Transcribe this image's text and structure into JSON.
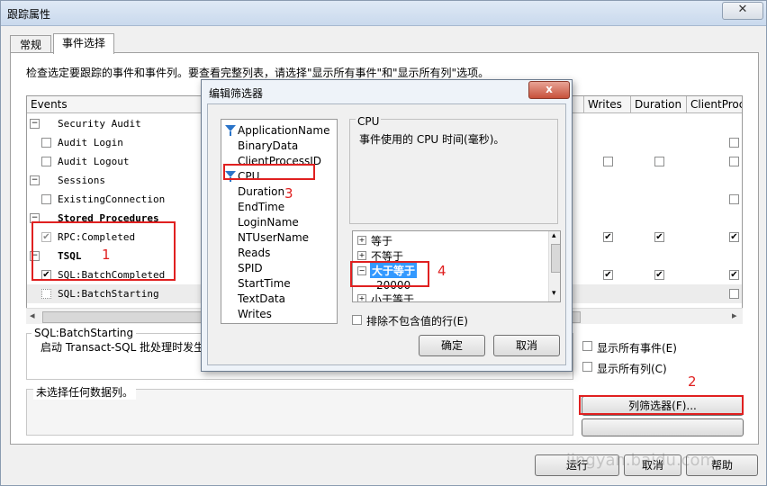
{
  "window": {
    "title": "跟踪属性",
    "close_glyph": "✕"
  },
  "tabs": [
    {
      "label": "常规"
    },
    {
      "label": "事件选择"
    }
  ],
  "instructions": "检查选定要跟踪的事件和事件列。要查看完整列表，请选择\"显示所有事件\"和\"显示所有列\"选项。",
  "grid": {
    "columns": [
      "Events",
      "Writes",
      "Duration",
      "ClientProc"
    ],
    "rows": [
      {
        "type": "category",
        "label": "Security Audit"
      },
      {
        "type": "event",
        "label": "Audit Login",
        "checked": false,
        "cols": [
          "",
          "",
          "unchecked"
        ]
      },
      {
        "type": "event",
        "label": "Audit Logout",
        "checked": false,
        "cols": [
          "unchecked",
          "unchecked",
          "unchecked"
        ]
      },
      {
        "type": "category",
        "label": "Sessions"
      },
      {
        "type": "event",
        "label": "ExistingConnection",
        "checked": false,
        "cols": [
          "",
          "",
          "unchecked"
        ]
      },
      {
        "type": "category",
        "label": "Stored Procedures",
        "bold": true
      },
      {
        "type": "event",
        "label": "RPC:Completed",
        "checked": true,
        "disabled": true,
        "cols": [
          "checked",
          "checked",
          "checked"
        ]
      },
      {
        "type": "category",
        "label": "TSQL",
        "bold": true
      },
      {
        "type": "event",
        "label": "SQL:BatchCompleted",
        "checked": true,
        "cols": [
          "checked",
          "checked",
          "checked"
        ]
      },
      {
        "type": "event",
        "label": "SQL:BatchStarting",
        "checked": false,
        "selected": true,
        "cols": [
          "",
          "",
          "unchecked"
        ]
      }
    ]
  },
  "description": {
    "title": "SQL:BatchStarting",
    "text": "启动 Transact-SQL 批处理时发生。"
  },
  "no_data": "未选择任何数据列。",
  "options": {
    "show_all_events": "显示所有事件(E)",
    "show_all_columns": "显示所有列(C)"
  },
  "buttons": {
    "column_filter": "列筛选器(F)...",
    "column_organize": "",
    "run": "运行",
    "cancel": "取消",
    "help": "帮助"
  },
  "dialog": {
    "title": "编辑筛选器",
    "close_glyph": "x",
    "columns": [
      {
        "label": "ApplicationName",
        "filtered": true
      },
      {
        "label": "BinaryData",
        "filtered": false
      },
      {
        "label": "ClientProcessID",
        "filtered": false
      },
      {
        "label": "CPU",
        "filtered": true
      },
      {
        "label": "Duration",
        "filtered": false
      },
      {
        "label": "EndTime",
        "filtered": false
      },
      {
        "label": "LoginName",
        "filtered": false
      },
      {
        "label": "NTUserName",
        "filtered": false
      },
      {
        "label": "Reads",
        "filtered": false
      },
      {
        "label": "SPID",
        "filtered": false
      },
      {
        "label": "StartTime",
        "filtered": false
      },
      {
        "label": "TextData",
        "filtered": false
      },
      {
        "label": "Writes",
        "filtered": false
      }
    ],
    "selected_column": "CPU",
    "column_description": "事件使用的 CPU 时间(毫秒)。",
    "operators": [
      {
        "label": "等于",
        "expanded": false
      },
      {
        "label": "不等于",
        "expanded": false
      },
      {
        "label": "大于等于",
        "expanded": true,
        "selected": true,
        "value": "20000"
      },
      {
        "label": "小于等于",
        "expanded": false
      }
    ],
    "tree_plus": "+",
    "tree_minus": "−",
    "exclude_label": "排除不包含值的行(E)",
    "ok": "确定",
    "cancel": "取消"
  },
  "annotations": {
    "n1": "1",
    "n2": "2",
    "n3": "3",
    "n4": "4"
  },
  "glyphs": {
    "minus": "−",
    "check": "✔",
    "arrow_left": "◂",
    "arrow_right": "▸",
    "arrow_up": "▴",
    "arrow_down": "▾"
  },
  "watermark": "jingyan.baidu.com"
}
